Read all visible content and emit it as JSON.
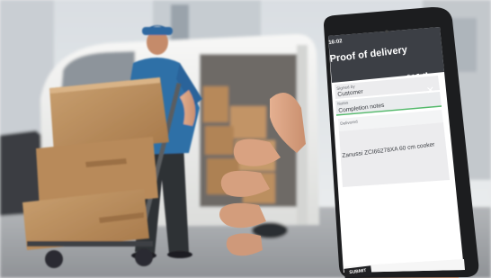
{
  "photo": {
    "description_tag": "delivery-worker-with-hand-truck-and-phone"
  },
  "phone": {
    "time": "16:02",
    "app_title": "Proof of delivery",
    "close_icon": "close-icon",
    "fields": [
      {
        "label": "Signed by",
        "value": "Customer"
      },
      {
        "label": "Notes",
        "value": "Completion notes"
      },
      {
        "label": "Delivered",
        "value": "Zanussi ZCI66278XA 60 cm cooker"
      }
    ],
    "submit_label": "SUBMIT"
  },
  "colors": {
    "app_bar": "#3c3f45",
    "accent_underline": "#54b96b",
    "van": "#f1f2f1",
    "shirt": "#2e6fa7",
    "box": "#b98c5d"
  }
}
